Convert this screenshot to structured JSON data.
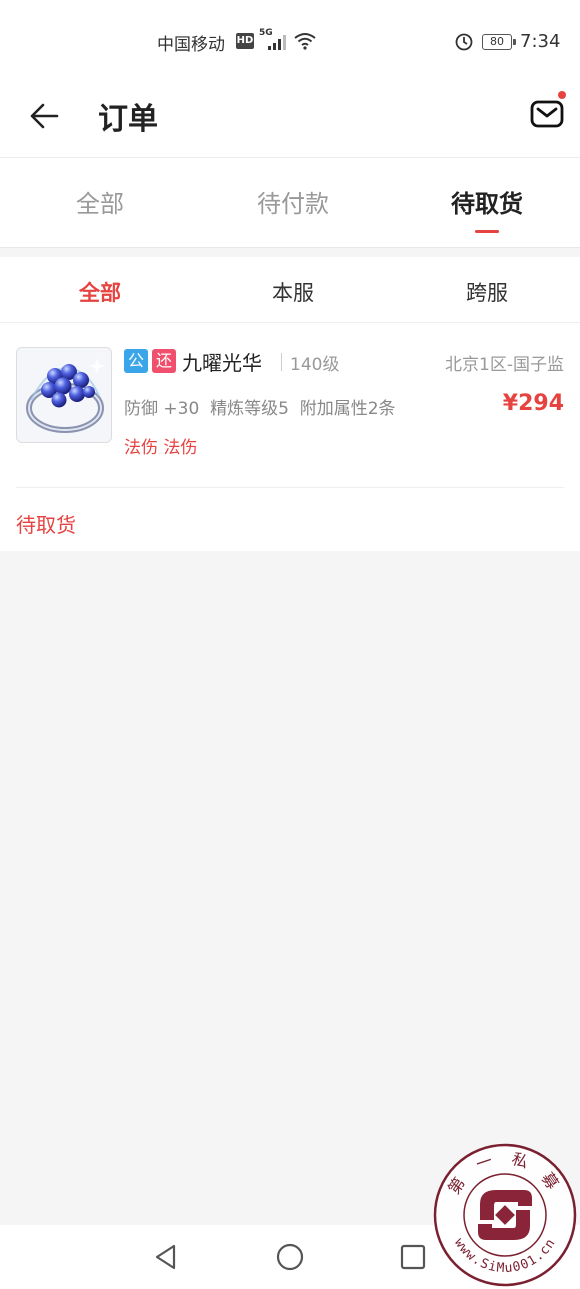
{
  "status_bar": {
    "carrier": "中国移动",
    "hd": "HD",
    "network": "5G",
    "battery": "80",
    "time": "7:34"
  },
  "header": {
    "title": "订单",
    "back_icon": "arrow-left-icon",
    "mail_icon": "mail-icon"
  },
  "tabs": [
    {
      "label": "全部",
      "active": false
    },
    {
      "label": "待付款",
      "active": false
    },
    {
      "label": "待取货",
      "active": true
    }
  ],
  "subtabs": [
    {
      "label": "全部",
      "active": true
    },
    {
      "label": "本服",
      "active": false
    },
    {
      "label": "跨服",
      "active": false
    }
  ],
  "order": {
    "tag_public": "公",
    "tag_return": "还",
    "name": "九曜光华",
    "level": "140级",
    "server": "北京1区-国子监",
    "attrs": "防御 +30  精炼等级5  附加属性2条",
    "price": "¥294",
    "effects": "法伤 法伤",
    "status": "待取货"
  },
  "nav": {
    "back": "triangle-back-icon",
    "home": "circle-home-icon",
    "recent": "square-recent-icon"
  },
  "watermark": {
    "text_top": "第 一 私 募",
    "text_bottom": "www.SiMu001.cn"
  },
  "colors": {
    "accent": "#e64340",
    "tag_blue": "#3aa5e8",
    "tag_pink": "#f0506e",
    "background": "#f5f5f5"
  }
}
